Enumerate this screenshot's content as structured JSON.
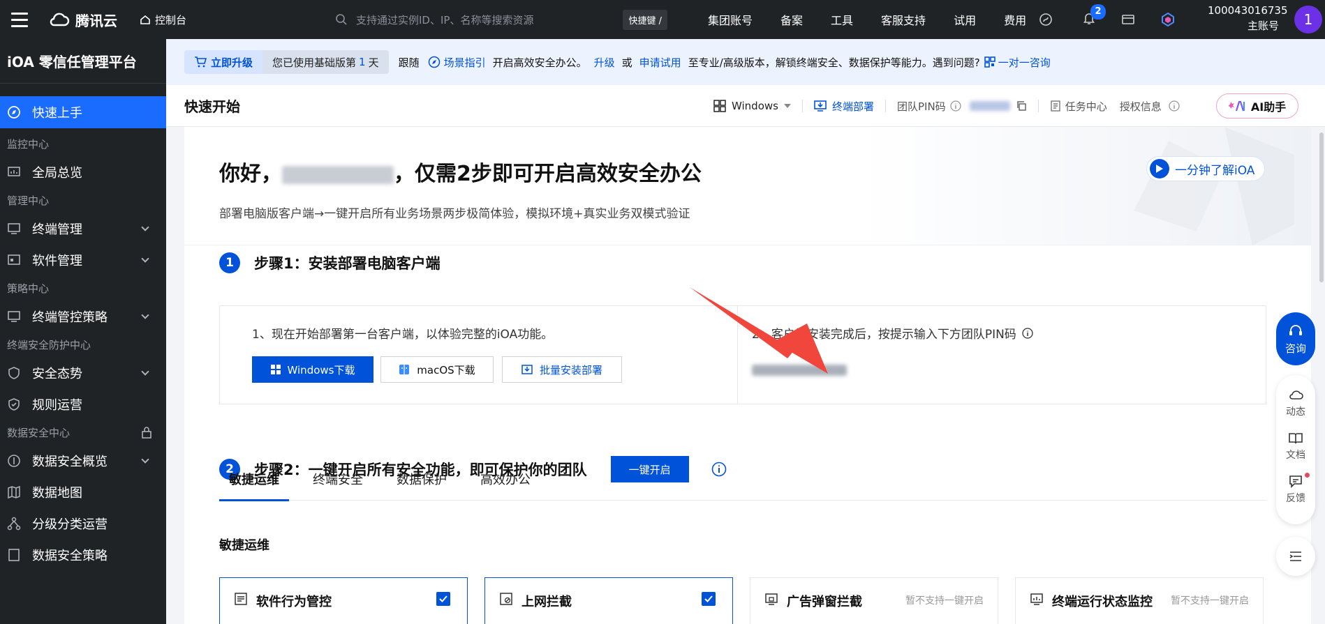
{
  "topbar": {
    "brand": "腾讯云",
    "console": "控制台",
    "search_placeholder": "支持通过实例ID、IP、名称等搜索资源",
    "shortcut": "快捷键 /",
    "nav": [
      "集团账号",
      "备案",
      "工具",
      "客服支持",
      "试用",
      "费用"
    ],
    "notification_count": "2",
    "account_id": "100043016735",
    "account_role": "主账号",
    "avatar": "1"
  },
  "sidebar": {
    "title": "iOA 零信任管理平台",
    "active": "快速上手",
    "groups": {
      "monitor": "监控中心",
      "manage": "管理中心",
      "policy": "策略中心",
      "endpoint_sec": "终端安全防护中心",
      "data_sec": "数据安全中心"
    },
    "items": {
      "overview": "全局总览",
      "endpoint_mgmt": "终端管理",
      "software_mgmt": "软件管理",
      "endpoint_policy": "终端管控策略",
      "sec_posture": "安全态势",
      "rule_ops": "规则运营",
      "data_overview": "数据安全概览",
      "data_map": "数据地图",
      "classify_ops": "分级分类运营",
      "data_policy": "数据安全策略"
    }
  },
  "banner": {
    "upgrade": "立即升级",
    "using": "您已使用基础版第",
    "days": "1",
    "day_unit": "天",
    "follow": "跟随",
    "guide": "场景指引",
    "text1": "开启高效安全办公。",
    "upgrade_link": "升级",
    "or": "或",
    "trial": "申请试用",
    "text2": "至专业/高级版本，解锁终端安全、数据保护等能力。遇到问题?",
    "consult": "一对一咨询"
  },
  "page_header": {
    "title": "快速开始",
    "os": "Windows",
    "deploy": "终端部署",
    "pin_label": "团队PIN码",
    "tasks": "任务中心",
    "license": "授权信息",
    "ai": "AI助手"
  },
  "hero": {
    "greeting_pre": "你好，",
    "greeting_post": "，仅需2步即可开启高效安全办公",
    "subtitle": "部署电脑版客户端→一键开启所有业务场景两步极简体验，模拟环境+真实业务双模式验证",
    "video": "一分钟了解iOA"
  },
  "step1": {
    "num": "1",
    "title": "步骤1：安装部署电脑客户端",
    "desc_left": "1、现在开始部署第一台客户端，以体验完整的iOA功能。",
    "btn_windows": "Windows下载",
    "btn_mac": "macOS下载",
    "btn_batch": "批量安装部署",
    "desc_right": "2、客户端安装完成后，按提示输入下方团队PIN码"
  },
  "step2": {
    "num": "2",
    "title": "步骤2：一键开启所有安全功能，即可保护你的团队",
    "btn": "一键开启"
  },
  "tabs": [
    "敏捷运维",
    "终端安全",
    "数据保护",
    "高效办公"
  ],
  "section_title": "敏捷运维",
  "features": [
    {
      "name": "软件行为管控",
      "checked": true,
      "note": ""
    },
    {
      "name": "上网拦截",
      "checked": true,
      "note": ""
    },
    {
      "name": "广告弹窗拦截",
      "checked": false,
      "note": "暂不支持一键开启"
    },
    {
      "name": "终端运行状态监控",
      "checked": false,
      "note": "暂不支持一键开启"
    }
  ],
  "float": {
    "consult": "咨询",
    "dynamic": "动态",
    "docs": "文档",
    "feedback": "反馈"
  },
  "colors": {
    "accent": "#0052d9",
    "topbar": "#202326",
    "active_nav": "#1a6bff",
    "arrow": "#f0463c"
  }
}
